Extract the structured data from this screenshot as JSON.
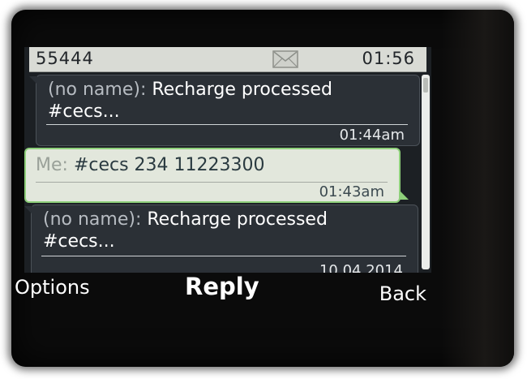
{
  "status_bar": {
    "sender_number": "55444",
    "clock": "01:56",
    "icon": "envelope-icon"
  },
  "messages": [
    {
      "direction": "incoming",
      "sender": "(no name):",
      "text_line1": "Recharge processed",
      "text_line2": "#cecs...",
      "time": "01:44am"
    },
    {
      "direction": "outgoing",
      "sender": "Me:",
      "text_line1": "#cecs 234 11223300",
      "time": "01:43am"
    },
    {
      "direction": "incoming",
      "sender": "(no name):",
      "text_line1": "Recharge processed",
      "text_line2": "#cecs...",
      "time": "10.04.2014"
    }
  ],
  "softkeys": {
    "left": "Options",
    "center": "Reply",
    "right": "Back"
  },
  "colors": {
    "screen_bg": "#1c2024",
    "incoming_bubble": "#2b3036",
    "outgoing_bubble": "#e2e7dc",
    "outgoing_border": "#8ecf7a",
    "status_bar_bg": "#d9dbd5"
  }
}
